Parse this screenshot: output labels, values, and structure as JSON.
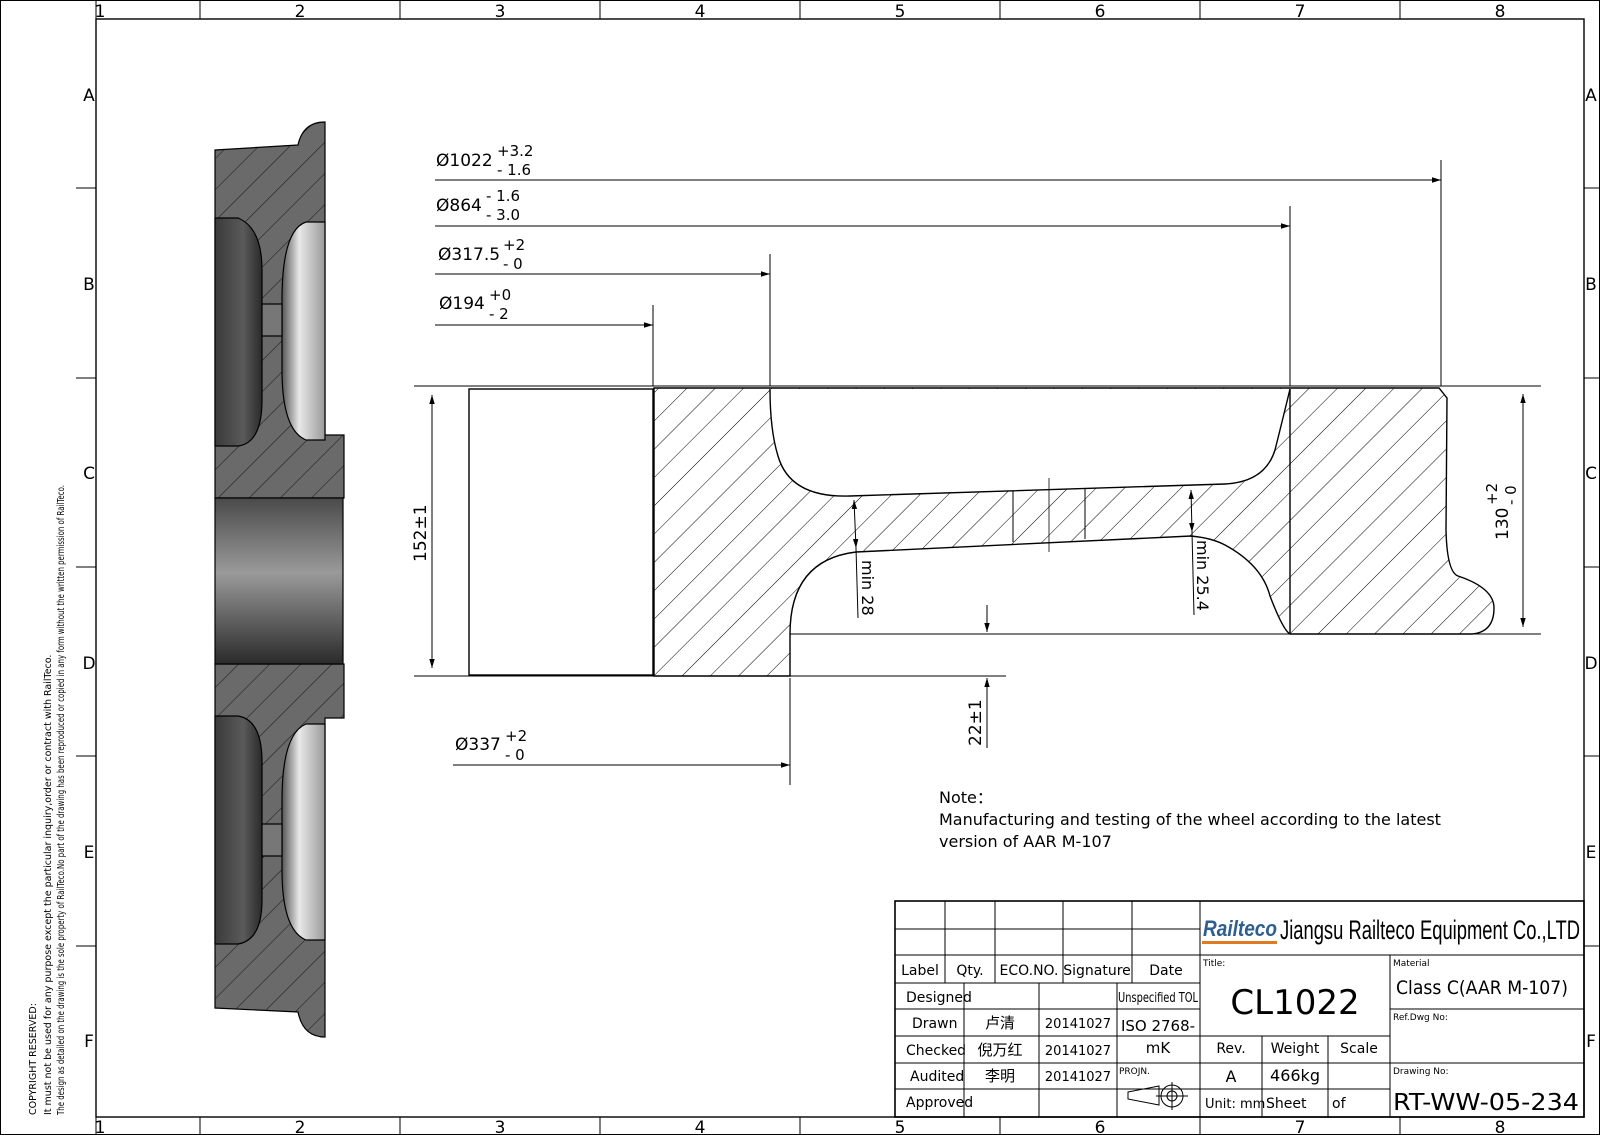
{
  "zones": {
    "columns": [
      "1",
      "2",
      "3",
      "4",
      "5",
      "6",
      "7",
      "8"
    ],
    "rows": [
      "A",
      "B",
      "C",
      "D",
      "E",
      "F"
    ]
  },
  "copyright": {
    "line1": "COPYRIGHT RESERVED:",
    "line2": "It must not be used for any purpose except the particular inquiry,order or contract with RailTeco.",
    "line3": "The design as detailed on the drawing is the sole property of RailTeco.No part of the drawing has been reproduced or copied in any form without the written permission of RailTeco."
  },
  "dimensions": {
    "d1022": {
      "sym": "Ø1022",
      "upper": "+3.2",
      "lower": "- 1.6"
    },
    "d864": {
      "sym": "Ø864",
      "upper": "- 1.6",
      "lower": "- 3.0"
    },
    "d3175": {
      "sym": "Ø317.5",
      "upper": "+2",
      "lower": "- 0"
    },
    "d194": {
      "sym": "Ø194",
      "upper": "+0",
      "lower": "- 2"
    },
    "d337": {
      "sym": "Ø337",
      "upper": "+2",
      "lower": "- 0"
    },
    "w152": "152±1",
    "w130": {
      "base": "130",
      "upper": "+2",
      "lower": "- 0"
    },
    "min28": "min 28",
    "min254": "min 25.4",
    "t22": "22±1"
  },
  "note": {
    "label": "Note：",
    "line1": "Manufacturing and testing of the wheel according to the latest",
    "line2": "version of AAR M-107"
  },
  "title_block": {
    "logo": "Railteco",
    "company": "Jiangsu Railteco Equipment Co.,LTD",
    "rev_headers": [
      "Label",
      "Qty.",
      "ECO.NO.",
      "Signature",
      "Date"
    ],
    "roles": [
      {
        "role": "Designed",
        "name": "",
        "date": ""
      },
      {
        "role": "Drawn",
        "name": "卢清",
        "date": "20141027"
      },
      {
        "role": "Checked",
        "name": "倪万红",
        "date": "20141027"
      },
      {
        "role": "Audited",
        "name": "李明",
        "date": "20141027"
      },
      {
        "role": "Approved",
        "name": "",
        "date": ""
      }
    ],
    "tol_label": "Unspecified TOL",
    "tol_value_1": "ISO 2768-",
    "tol_value_2": "mK",
    "projn_label": "PROJN.",
    "title_label": "Title:",
    "title": "CL1022",
    "rev_label": "Rev.",
    "weight_label": "Weight",
    "scale_label": "Scale",
    "rev": "A",
    "weight": "466kg",
    "unit_label": "Unit: mm",
    "sheet_label": "Sheet",
    "of_label": "of",
    "material_label": "Material",
    "material": "Class C(AAR M-107)",
    "ref_label": "Ref.Dwg No:",
    "drawing_label": "Drawing No:",
    "drawing_no": "RT-WW-05-234"
  },
  "colors": {
    "ink": "#000000",
    "logo": "#2e5f8f",
    "accent": "#e07a22"
  }
}
